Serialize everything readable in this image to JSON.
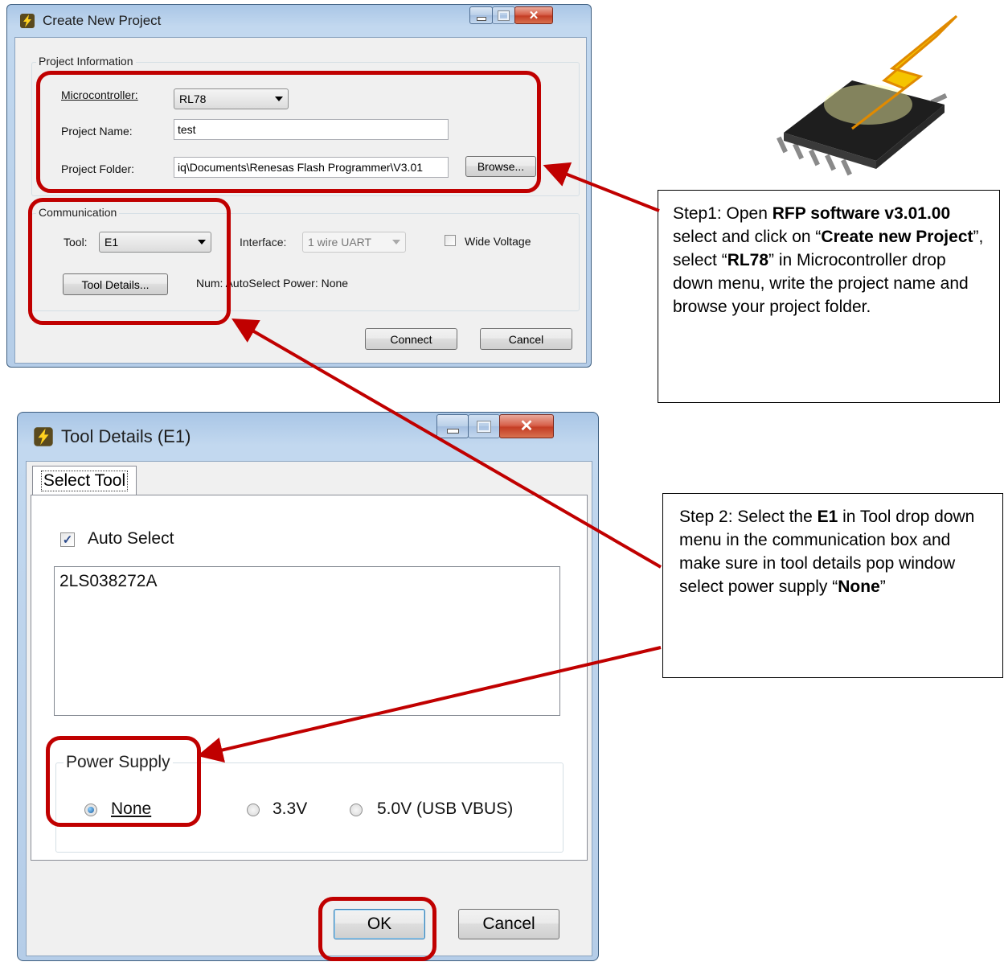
{
  "create_project_window": {
    "title": "Create New Project",
    "project_info_group": "Project Information",
    "microcontroller_label": "Microcontroller:",
    "microcontroller_value": "RL78",
    "project_name_label": "Project Name:",
    "project_name_value": "test",
    "project_folder_label": "Project Folder:",
    "project_folder_value": "iq\\Documents\\Renesas Flash Programmer\\V3.01",
    "browse_button": "Browse...",
    "communication_group": "Communication",
    "tool_label": "Tool:",
    "tool_value": "E1",
    "interface_label": "Interface:",
    "interface_value": "1 wire UART",
    "wide_voltage_label": "Wide Voltage",
    "tool_details_button": "Tool Details...",
    "status_text": "Num: AutoSelect  Power: None",
    "connect_button": "Connect",
    "cancel_button": "Cancel"
  },
  "tool_details_window": {
    "title": "Tool Details (E1)",
    "tab_label": "Select Tool",
    "auto_select_label": "Auto Select",
    "auto_select_checked": true,
    "tool_list": [
      "2LS038272A"
    ],
    "power_supply_group": "Power Supply",
    "power_options": [
      "None",
      "3.3V",
      "5.0V (USB VBUS)"
    ],
    "selected_power": "None",
    "ok_button": "OK",
    "cancel_button": "Cancel"
  },
  "callout_step1": {
    "t1": "Step1: Open ",
    "b1": "RFP software v3.01.00",
    "t2": " select and click on “",
    "b2": "Create new Project",
    "t3": "”, select “",
    "b3": "RL78",
    "t4": "” in Microcontroller drop down menu, write the project name and browse your project folder."
  },
  "callout_step2": {
    "t1": "Step 2: Select the ",
    "b1": "E1",
    "t2": " in Tool drop down menu in the communication box and make sure in tool details pop window select power supply “",
    "b2": "None",
    "t3": "”"
  },
  "colors": {
    "annotation_red": "#c00000",
    "window_frame": "#b5cde8",
    "dialog_background": "#f0f0f0"
  },
  "icons": [
    "lightning-app-icon",
    "minimize-icon",
    "maximize-icon",
    "close-icon",
    "microchip-lightning-icon",
    "dropdown-caret-icon",
    "checkmark-icon"
  ]
}
